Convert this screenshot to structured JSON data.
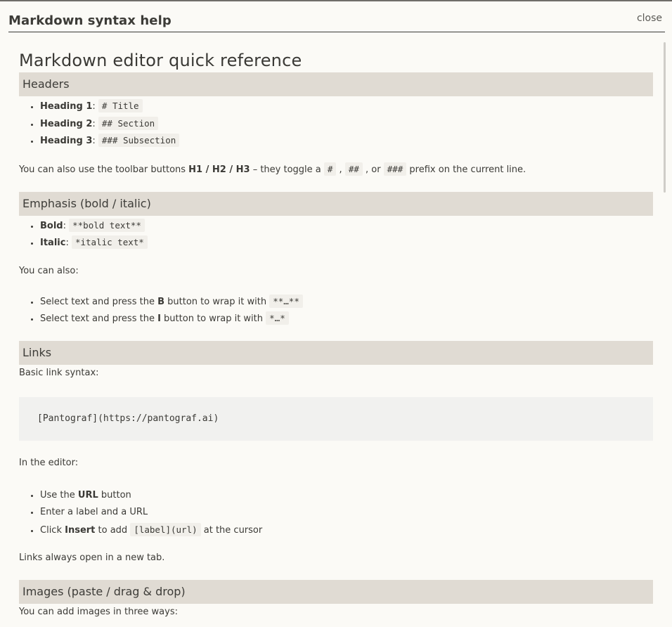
{
  "dialog": {
    "title": "Markdown syntax help",
    "close_label": "close"
  },
  "doc": {
    "title": "Markdown editor quick reference"
  },
  "headers": {
    "title": "Headers",
    "items": [
      {
        "label": "Heading 1",
        "sep": ": ",
        "code": "# Title"
      },
      {
        "label": "Heading 2",
        "sep": ": ",
        "code": "## Section"
      },
      {
        "label": "Heading 3",
        "sep": ": ",
        "code": "### Subsection"
      }
    ],
    "para_prefix": "You can also use the toolbar buttons ",
    "para_bold": "H1 / H2 / H3",
    "para_mid": " – they toggle a ",
    "code1": "#",
    "comma1": " , ",
    "code2": "##",
    "comma2": " , or ",
    "code3": "###",
    "para_suffix": " prefix on the current line."
  },
  "emphasis": {
    "title": "Emphasis (bold / italic)",
    "items": [
      {
        "label": "Bold",
        "sep": ": ",
        "code": "**bold text**"
      },
      {
        "label": "Italic",
        "sep": ": ",
        "code": "*italic text*"
      }
    ],
    "also": "You can also:",
    "tips": [
      {
        "prefix": "Select text and press the ",
        "bold": "B",
        "suffix": " button to wrap it with ",
        "code": "**…**"
      },
      {
        "prefix": "Select text and press the ",
        "bold": "I",
        "suffix": " button to wrap it with ",
        "code": "*…*"
      }
    ]
  },
  "links": {
    "title": "Links",
    "basic": "Basic link syntax:",
    "code_block": "[Pantograf](https://pantograf.ai)",
    "in_editor": "In the editor:",
    "steps": [
      {
        "prefix": "Use the ",
        "bold": "URL",
        "suffix": " button"
      },
      {
        "prefix": "Enter a label and a URL",
        "bold": "",
        "suffix": ""
      },
      {
        "prefix": "Click ",
        "bold": "Insert",
        "suffix": " to add ",
        "code": "[label](url)",
        "tail": " at the cursor"
      }
    ],
    "note": "Links always open in a new tab."
  },
  "images": {
    "title": "Images (paste / drag & drop)",
    "intro": "You can add images in three ways:"
  }
}
